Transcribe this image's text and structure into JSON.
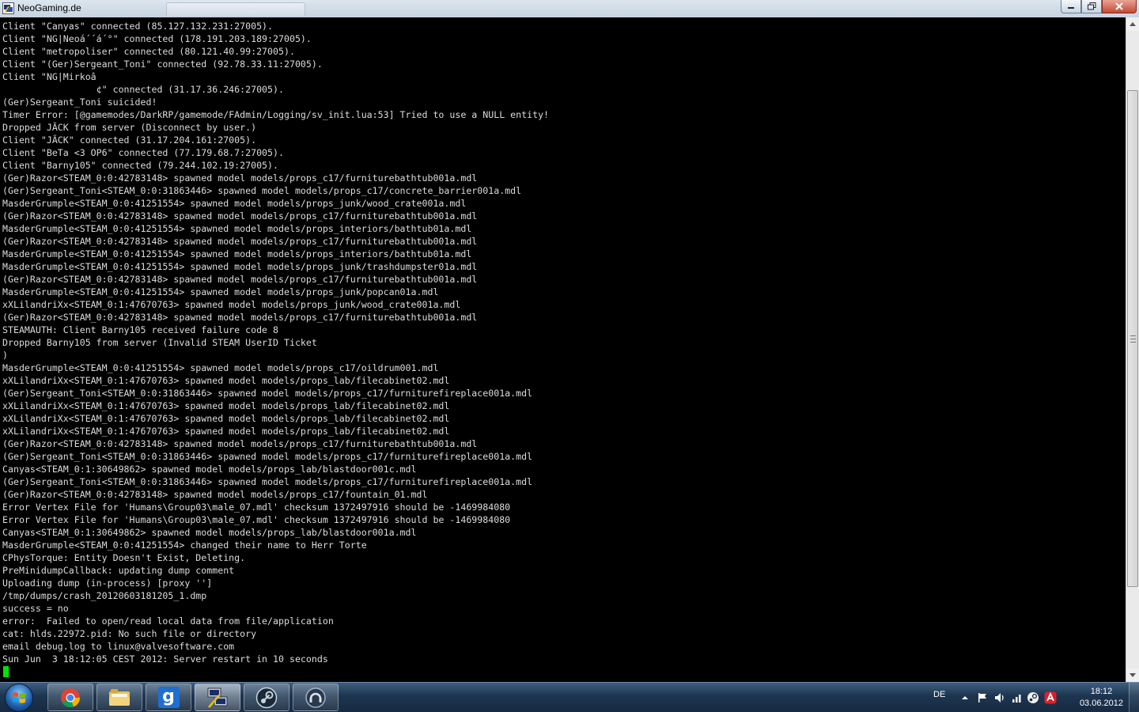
{
  "window": {
    "title": "NeoGaming.de"
  },
  "console": {
    "lines": [
      "Client \"Canyas\" connected (85.127.132.231:27005).",
      "Client \"NG|Neoá´´á´°\" connected (178.191.203.189:27005).",
      "Client \"metropoliser\" connected (80.121.40.99:27005).",
      "Client \"(Ger)Sergeant_Toni\" connected (92.78.33.11:27005).",
      "Client \"NG|Mirkoâ",
      "                 ¢\" connected (31.17.36.246:27005).",
      "(Ger)Sergeant_Toni suicided!",
      "Timer Error: [@gamemodes/DarkRP/gamemode/FAdmin/Logging/sv_init.lua:53] Tried to use a NULL entity!",
      "Dropped JÃCK from server (Disconnect by user.)",
      "Client \"JÃCK\" connected (31.17.204.161:27005).",
      "Client \"BeTa <3 OP6\" connected (77.179.68.7:27005).",
      "Client \"Barny105\" connected (79.244.102.19:27005).",
      "(Ger)Razor<STEAM_0:0:42783148> spawned model models/props_c17/furniturebathtub001a.mdl",
      "(Ger)Sergeant_Toni<STEAM_0:0:31863446> spawned model models/props_c17/concrete_barrier001a.mdl",
      "MasderGrumple<STEAM_0:0:41251554> spawned model models/props_junk/wood_crate001a.mdl",
      "(Ger)Razor<STEAM_0:0:42783148> spawned model models/props_c17/furniturebathtub001a.mdl",
      "MasderGrumple<STEAM_0:0:41251554> spawned model models/props_interiors/bathtub01a.mdl",
      "(Ger)Razor<STEAM_0:0:42783148> spawned model models/props_c17/furniturebathtub001a.mdl",
      "MasderGrumple<STEAM_0:0:41251554> spawned model models/props_interiors/bathtub01a.mdl",
      "MasderGrumple<STEAM_0:0:41251554> spawned model models/props_junk/trashdumpster01a.mdl",
      "(Ger)Razor<STEAM_0:0:42783148> spawned model models/props_c17/furniturebathtub001a.mdl",
      "MasderGrumple<STEAM_0:0:41251554> spawned model models/props_junk/popcan01a.mdl",
      "xXLilandriXx<STEAM_0:1:47670763> spawned model models/props_junk/wood_crate001a.mdl",
      "(Ger)Razor<STEAM_0:0:42783148> spawned model models/props_c17/furniturebathtub001a.mdl",
      "STEAMAUTH: Client Barny105 received failure code 8",
      "Dropped Barny105 from server (Invalid STEAM UserID Ticket",
      ")",
      "MasderGrumple<STEAM_0:0:41251554> spawned model models/props_c17/oildrum001.mdl",
      "xXLilandriXx<STEAM_0:1:47670763> spawned model models/props_lab/filecabinet02.mdl",
      "(Ger)Sergeant_Toni<STEAM_0:0:31863446> spawned model models/props_c17/furniturefireplace001a.mdl",
      "xXLilandriXx<STEAM_0:1:47670763> spawned model models/props_lab/filecabinet02.mdl",
      "xXLilandriXx<STEAM_0:1:47670763> spawned model models/props_lab/filecabinet02.mdl",
      "xXLilandriXx<STEAM_0:1:47670763> spawned model models/props_lab/filecabinet02.mdl",
      "(Ger)Razor<STEAM_0:0:42783148> spawned model models/props_c17/furniturebathtub001a.mdl",
      "(Ger)Sergeant_Toni<STEAM_0:0:31863446> spawned model models/props_c17/furniturefireplace001a.mdl",
      "Canyas<STEAM_0:1:30649862> spawned model models/props_lab/blastdoor001c.mdl",
      "(Ger)Sergeant_Toni<STEAM_0:0:31863446> spawned model models/props_c17/furniturefireplace001a.mdl",
      "(Ger)Razor<STEAM_0:0:42783148> spawned model models/props_c17/fountain_01.mdl",
      "Error Vertex File for 'Humans\\Group03\\male_07.mdl' checksum 1372497916 should be -1469984080",
      "Error Vertex File for 'Humans\\Group03\\male_07.mdl' checksum 1372497916 should be -1469984080",
      "Canyas<STEAM_0:1:30649862> spawned model models/props_lab/blastdoor001a.mdl",
      "MasderGrumple<STEAM_0:0:41251554> changed their name to Herr Torte",
      "CPhysTorque: Entity Doesn't Exist, Deleting.",
      "PreMinidumpCallback: updating dump comment",
      "Uploading dump (in-process) [proxy '']",
      "/tmp/dumps/crash_20120603181205_1.dmp",
      "success = no",
      "error:  Failed to open/read local data from file/application",
      "cat: hlds.22972.pid: No such file or directory",
      "email debug.log to linux@valvesoftware.com",
      "Sun Jun  3 18:12:05 CEST 2012: Server restart in 10 seconds"
    ],
    "cursor_color": "#00e000"
  },
  "scrollbar": {
    "position": 0.42
  },
  "taskbar": {
    "buttons": [
      {
        "name": "chrome",
        "icon": "chrome-icon"
      },
      {
        "name": "explorer",
        "icon": "folder-icon"
      },
      {
        "name": "gmod",
        "icon": "gmod-icon",
        "label": "g"
      },
      {
        "name": "putty",
        "icon": "putty-icon"
      },
      {
        "name": "steam",
        "icon": "steam-icon"
      },
      {
        "name": "teamspeak",
        "icon": "teamspeak-icon"
      }
    ],
    "active": "putty"
  },
  "tray": {
    "language": "DE",
    "icons": [
      "arrow-up-icon",
      "flag-icon",
      "volume-icon",
      "network-icon",
      "steam-tray-icon",
      "antivirus-icon"
    ]
  },
  "clock": {
    "time": "18:12",
    "date": "03.06.2012"
  }
}
